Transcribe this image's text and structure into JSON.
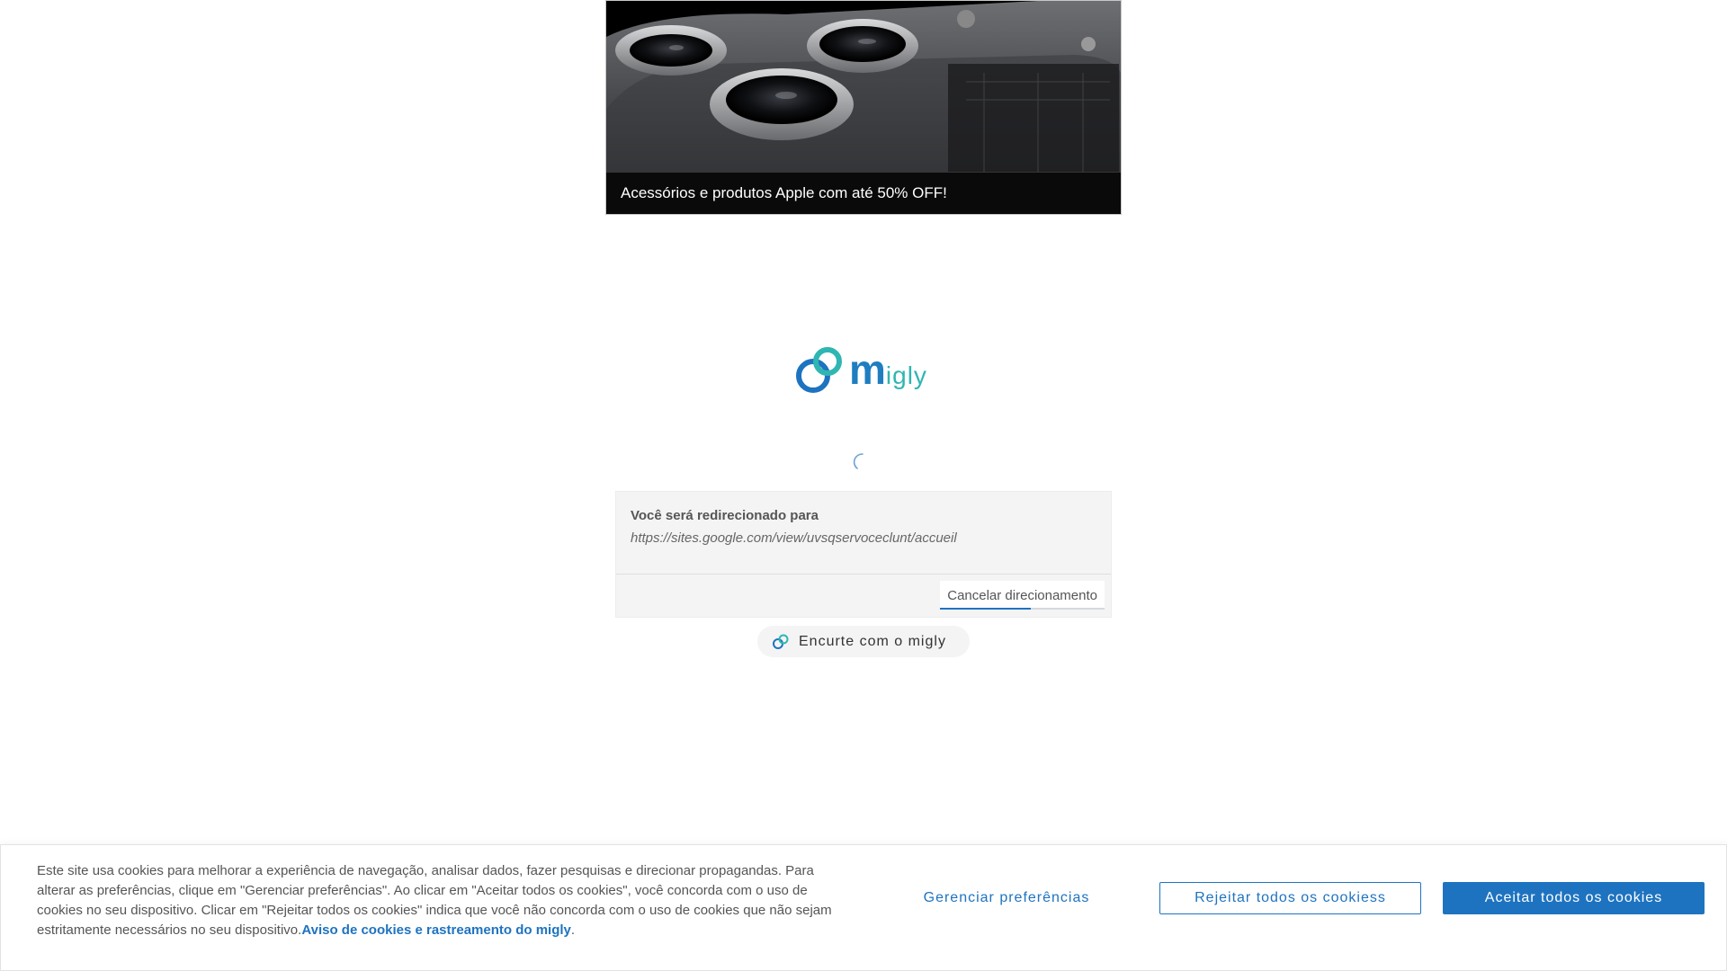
{
  "ad": {
    "caption": "Acessórios e produtos Apple com até 50% OFF!",
    "image_icon": "phone-camera-image"
  },
  "logo": {
    "m": "m",
    "rest": "igly",
    "icon": "chain-link-logo-icon"
  },
  "redirect": {
    "title": "Você será redirecionado para",
    "url": "https://sites.google.com/view/uvsqservoceclunt/accueil",
    "cancel_label": "Cancelar direcionamento",
    "progress": 0.55
  },
  "shorten": {
    "label": "Encurte com o migly",
    "icon": "link-icon"
  },
  "cookie": {
    "text": "Este site usa cookies para melhorar a experiência de navegação, analisar dados, fazer pesquisas e direcionar propagandas. Para alterar as preferências, clique em \"Gerenciar preferências\". Ao clicar em \"Aceitar todos os cookies\", você concorda com o uso de cookies no seu dispositivo. Clicar em \"Rejeitar todos os cookies\" indica que você não concorda com o uso de cookies que não sejam estritamente necessários no seu dispositivo.",
    "link_label": "Aviso de cookies e rastreamento do migly",
    "trailing": ".",
    "manage_label": "Gerenciar preferências",
    "reject_label": "Rejeitar todos os cookiess",
    "accept_label": "Aceitar todos os cookies"
  },
  "colors": {
    "brand_blue": "#1e73c0",
    "brand_teal": "#2fb6b2"
  }
}
